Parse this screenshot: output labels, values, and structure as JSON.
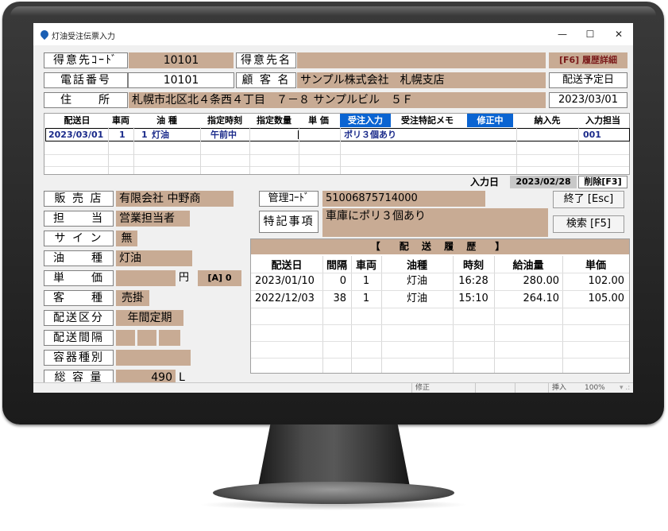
{
  "window": {
    "title": "灯油受注伝票入力",
    "minimize": "—",
    "maximize": "☐",
    "close": "✕"
  },
  "customer": {
    "code_label": "得意先ｺｰﾄﾞ",
    "code_value": "10101",
    "name_label": "得意先名",
    "name_value": "",
    "phone_label": "電話番号",
    "phone_value": "10101",
    "client_label": "顧 客 名",
    "client_value": "サンプル株式会社　札幌支店",
    "address_label": "住　　所",
    "address_value": "札幌市北区北４条西４丁目　７－８ サンプルビル　５Ｆ"
  },
  "right_panel": {
    "history_detail_button": "[F6] 履歴詳細",
    "delivery_date_label": "配送予定日",
    "delivery_date_value": "2023/03/01"
  },
  "order_grid": {
    "headers": [
      "配送日",
      "車両",
      "油 種",
      "指定時刻",
      "指定数量",
      "単 価",
      "受注入力",
      "受注特記メモ",
      "修正中",
      "納入先",
      "入力担当"
    ],
    "rows": [
      {
        "date": "2023/03/01",
        "vehicle": "1",
        "oil_no": "1",
        "oil": "灯油",
        "time": "午前中",
        "qty": "",
        "price": "",
        "memo": "ポリ３個あり",
        "dest": "",
        "staff": "001"
      }
    ]
  },
  "entry": {
    "label": "入力日",
    "date": "2023/02/28",
    "delete_button": "削除[F3]"
  },
  "details": {
    "shop_label": "販 売 店",
    "shop_value": "有限会社 中野商",
    "staff_label": "担　　当",
    "staff_value": "営業担当者",
    "sign_label": "サ イ ン",
    "sign_value": "無",
    "oil_label": "油　　種",
    "oil_value": "灯油",
    "price_label": "単　　価",
    "price_value": "",
    "price_unit": "円",
    "price_code": "[A] 0",
    "ctype_label": "客　　種",
    "ctype_value": "売掛",
    "dclass_label": "配送区分",
    "dclass_value": "年間定期",
    "dinterval_label": "配送間隔",
    "container_label": "容器種別",
    "container_value": "",
    "capacity_label": "総 容 量",
    "capacity_value": "490",
    "capacity_unit": "L"
  },
  "management": {
    "code_label": "管理ｺｰﾄﾞ",
    "code_value": "51006875714000",
    "note_label": "特記事項",
    "note_value": "車庫にポリ３個あり",
    "exit_button": "終了 [Esc]",
    "search_button": "検索 [F5]"
  },
  "history": {
    "title": "【　配 送 履 歴　】",
    "headers": [
      "配送日",
      "間隔",
      "車両",
      "油種",
      "時刻",
      "給油量",
      "単価"
    ],
    "rows": [
      {
        "date": "2023/01/10",
        "interval": "0",
        "vehicle": "1",
        "oil": "灯油",
        "time": "16:28",
        "amount": "280.00",
        "price": "102.00"
      },
      {
        "date": "2022/12/03",
        "interval": "38",
        "vehicle": "1",
        "oil": "灯油",
        "time": "15:10",
        "amount": "264.10",
        "price": "105.00"
      }
    ]
  },
  "status_bar": {
    "mode": "修正",
    "insert": "挿入",
    "zoom": "100%"
  }
}
